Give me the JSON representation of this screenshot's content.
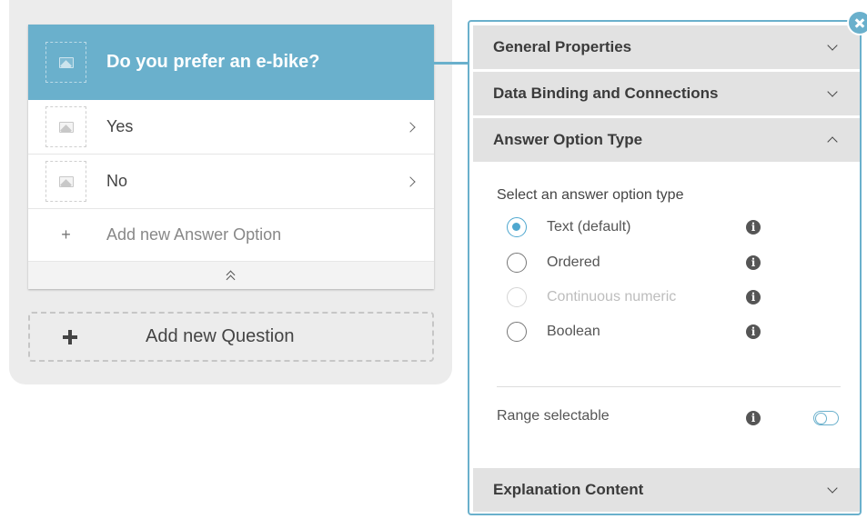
{
  "question": {
    "title": "Do you prefer an e-bike?",
    "options": [
      {
        "label": "Yes"
      },
      {
        "label": "No"
      }
    ],
    "add_option_label": "Add new Answer Option"
  },
  "add_question_label": "Add new Question",
  "properties": {
    "sections": {
      "general": "General Properties",
      "data_binding": "Data Binding and Connections",
      "answer_option_type": "Answer Option Type",
      "explanation": "Explanation Content"
    },
    "answer_option_type": {
      "prompt": "Select an answer option type",
      "options": [
        {
          "label": "Text (default)",
          "selected": true,
          "disabled": false
        },
        {
          "label": "Ordered",
          "selected": false,
          "disabled": false
        },
        {
          "label": "Continuous numeric",
          "selected": false,
          "disabled": true
        },
        {
          "label": "Boolean",
          "selected": false,
          "disabled": false
        }
      ],
      "range_selectable_label": "Range selectable",
      "range_selectable_on": false
    }
  },
  "colors": {
    "accent": "#6ab0cc",
    "radio_selected": "#4ea7cf",
    "section_bg": "#e2e2e2"
  }
}
